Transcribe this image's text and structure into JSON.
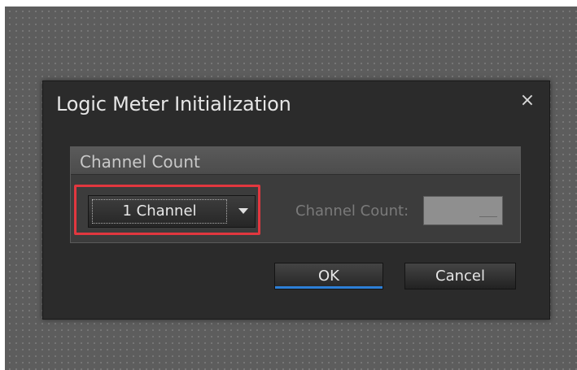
{
  "dialog": {
    "title": "Logic Meter Initialization",
    "close_icon": "close-icon"
  },
  "group": {
    "title": "Channel Count"
  },
  "channel_select": {
    "selected": "1 Channel",
    "arrow_icon": "chevron-down-icon"
  },
  "channel_count": {
    "label": "Channel Count:",
    "value": ""
  },
  "buttons": {
    "ok": "OK",
    "cancel": "Cancel"
  },
  "colors": {
    "highlight": "#e2373f",
    "ok_accent": "#2d7fd6"
  }
}
